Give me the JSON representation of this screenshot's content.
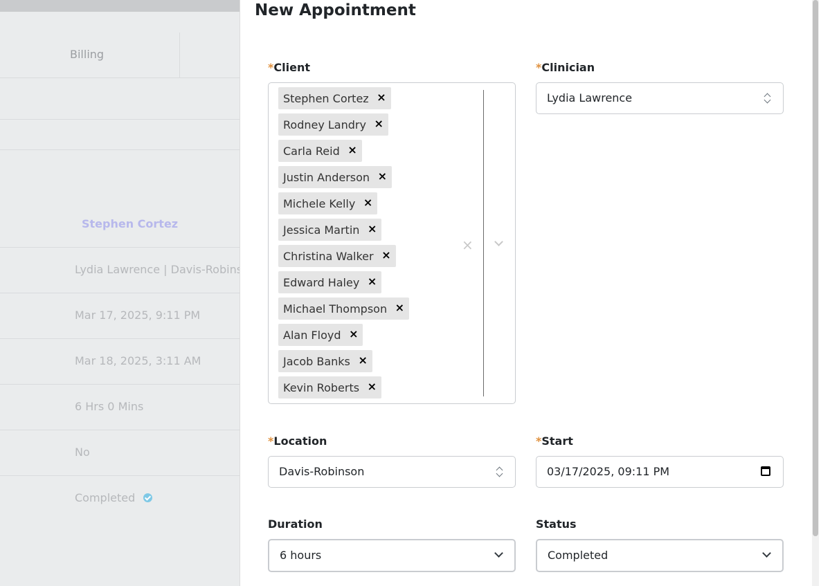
{
  "background": {
    "tab_billing": "Billing",
    "client_name": "Stephen Cortez",
    "rows": [
      "Lydia Lawrence | Davis-Robinson",
      "Mar 17, 2025, 9:11 PM",
      "Mar 18, 2025, 3:11 AM",
      "6 Hrs 0 Mins",
      "No",
      "Completed"
    ]
  },
  "modal": {
    "title": "New Appointment",
    "required_marker": "*",
    "client": {
      "label": "Client",
      "selected": [
        "Stephen Cortez",
        "Rodney Landry",
        "Carla Reid",
        "Justin Anderson",
        "Michele Kelly",
        "Jessica Martin",
        "Christina Walker",
        "Edward Haley",
        "Michael Thompson",
        "Alan Floyd",
        "Jacob Banks",
        "Kevin Roberts"
      ],
      "remove_glyph": "×",
      "clear_glyph": "×"
    },
    "clinician": {
      "label": "Clinician",
      "value": "Lydia Lawrence"
    },
    "location": {
      "label": "Location",
      "value": "Davis-Robinson"
    },
    "start": {
      "label": "Start",
      "value": "03/17/2025, 09:11 PM"
    },
    "duration": {
      "label": "Duration",
      "value": "6 hours"
    },
    "status": {
      "label": "Status",
      "value": "Completed"
    }
  },
  "colors": {
    "required": "#e0913f",
    "chip_bg": "#e5e5e5",
    "accent_name": "#b7b8ec"
  }
}
